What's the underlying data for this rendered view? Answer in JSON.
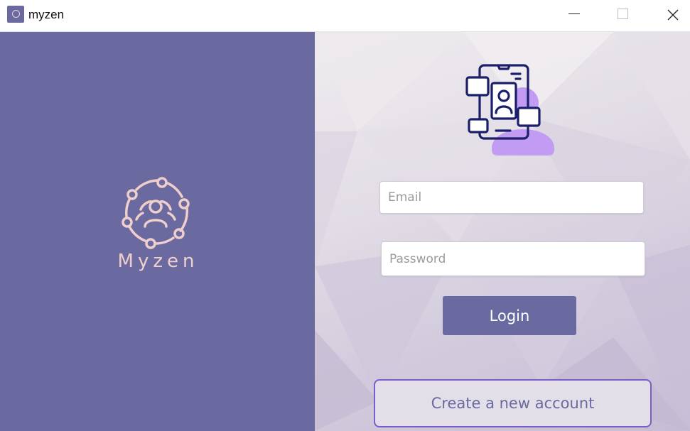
{
  "window": {
    "title": "myzen",
    "controls": [
      "minimize-icon",
      "maximize-icon",
      "close-icon"
    ]
  },
  "brand": {
    "name": "Myzen",
    "logo_icon": "network-people-icon",
    "logo_color": "#efcfcb",
    "panel_color": "#6b6aa0"
  },
  "login_form": {
    "hero_icon": "mobile-user-profile-icon",
    "email": {
      "placeholder": "Email",
      "value": ""
    },
    "password": {
      "placeholder": "Password",
      "value": ""
    },
    "login_label": "Login",
    "create_account_label": "Create a new account",
    "accent_color": "#6b6aa0",
    "create_border_color": "#7a5ec8"
  }
}
